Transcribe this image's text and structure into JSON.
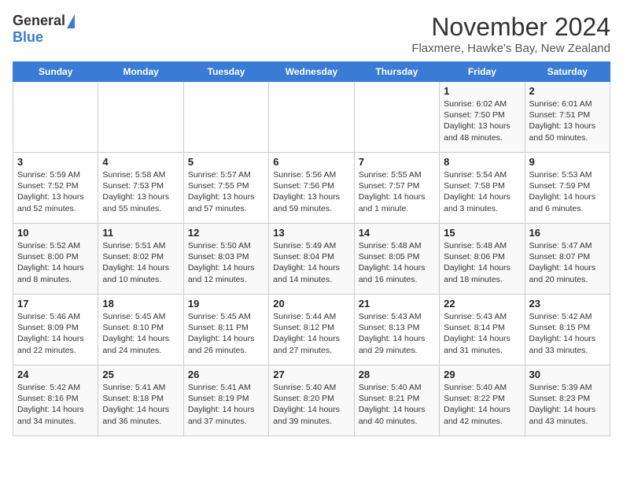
{
  "header": {
    "logo_general": "General",
    "logo_blue": "Blue",
    "month_title": "November 2024",
    "subtitle": "Flaxmere, Hawke's Bay, New Zealand"
  },
  "days_of_week": [
    "Sunday",
    "Monday",
    "Tuesday",
    "Wednesday",
    "Thursday",
    "Friday",
    "Saturday"
  ],
  "weeks": [
    [
      {
        "day": "",
        "info": ""
      },
      {
        "day": "",
        "info": ""
      },
      {
        "day": "",
        "info": ""
      },
      {
        "day": "",
        "info": ""
      },
      {
        "day": "",
        "info": ""
      },
      {
        "day": "1",
        "info": "Sunrise: 6:02 AM\nSunset: 7:50 PM\nDaylight: 13 hours\nand 48 minutes."
      },
      {
        "day": "2",
        "info": "Sunrise: 6:01 AM\nSunset: 7:51 PM\nDaylight: 13 hours\nand 50 minutes."
      }
    ],
    [
      {
        "day": "3",
        "info": "Sunrise: 5:59 AM\nSunset: 7:52 PM\nDaylight: 13 hours\nand 52 minutes."
      },
      {
        "day": "4",
        "info": "Sunrise: 5:58 AM\nSunset: 7:53 PM\nDaylight: 13 hours\nand 55 minutes."
      },
      {
        "day": "5",
        "info": "Sunrise: 5:57 AM\nSunset: 7:55 PM\nDaylight: 13 hours\nand 57 minutes."
      },
      {
        "day": "6",
        "info": "Sunrise: 5:56 AM\nSunset: 7:56 PM\nDaylight: 13 hours\nand 59 minutes."
      },
      {
        "day": "7",
        "info": "Sunrise: 5:55 AM\nSunset: 7:57 PM\nDaylight: 14 hours\nand 1 minute."
      },
      {
        "day": "8",
        "info": "Sunrise: 5:54 AM\nSunset: 7:58 PM\nDaylight: 14 hours\nand 3 minutes."
      },
      {
        "day": "9",
        "info": "Sunrise: 5:53 AM\nSunset: 7:59 PM\nDaylight: 14 hours\nand 6 minutes."
      }
    ],
    [
      {
        "day": "10",
        "info": "Sunrise: 5:52 AM\nSunset: 8:00 PM\nDaylight: 14 hours\nand 8 minutes."
      },
      {
        "day": "11",
        "info": "Sunrise: 5:51 AM\nSunset: 8:02 PM\nDaylight: 14 hours\nand 10 minutes."
      },
      {
        "day": "12",
        "info": "Sunrise: 5:50 AM\nSunset: 8:03 PM\nDaylight: 14 hours\nand 12 minutes."
      },
      {
        "day": "13",
        "info": "Sunrise: 5:49 AM\nSunset: 8:04 PM\nDaylight: 14 hours\nand 14 minutes."
      },
      {
        "day": "14",
        "info": "Sunrise: 5:48 AM\nSunset: 8:05 PM\nDaylight: 14 hours\nand 16 minutes."
      },
      {
        "day": "15",
        "info": "Sunrise: 5:48 AM\nSunset: 8:06 PM\nDaylight: 14 hours\nand 18 minutes."
      },
      {
        "day": "16",
        "info": "Sunrise: 5:47 AM\nSunset: 8:07 PM\nDaylight: 14 hours\nand 20 minutes."
      }
    ],
    [
      {
        "day": "17",
        "info": "Sunrise: 5:46 AM\nSunset: 8:09 PM\nDaylight: 14 hours\nand 22 minutes."
      },
      {
        "day": "18",
        "info": "Sunrise: 5:45 AM\nSunset: 8:10 PM\nDaylight: 14 hours\nand 24 minutes."
      },
      {
        "day": "19",
        "info": "Sunrise: 5:45 AM\nSunset: 8:11 PM\nDaylight: 14 hours\nand 26 minutes."
      },
      {
        "day": "20",
        "info": "Sunrise: 5:44 AM\nSunset: 8:12 PM\nDaylight: 14 hours\nand 27 minutes."
      },
      {
        "day": "21",
        "info": "Sunrise: 5:43 AM\nSunset: 8:13 PM\nDaylight: 14 hours\nand 29 minutes."
      },
      {
        "day": "22",
        "info": "Sunrise: 5:43 AM\nSunset: 8:14 PM\nDaylight: 14 hours\nand 31 minutes."
      },
      {
        "day": "23",
        "info": "Sunrise: 5:42 AM\nSunset: 8:15 PM\nDaylight: 14 hours\nand 33 minutes."
      }
    ],
    [
      {
        "day": "24",
        "info": "Sunrise: 5:42 AM\nSunset: 8:16 PM\nDaylight: 14 hours\nand 34 minutes."
      },
      {
        "day": "25",
        "info": "Sunrise: 5:41 AM\nSunset: 8:18 PM\nDaylight: 14 hours\nand 36 minutes."
      },
      {
        "day": "26",
        "info": "Sunrise: 5:41 AM\nSunset: 8:19 PM\nDaylight: 14 hours\nand 37 minutes."
      },
      {
        "day": "27",
        "info": "Sunrise: 5:40 AM\nSunset: 8:20 PM\nDaylight: 14 hours\nand 39 minutes."
      },
      {
        "day": "28",
        "info": "Sunrise: 5:40 AM\nSunset: 8:21 PM\nDaylight: 14 hours\nand 40 minutes."
      },
      {
        "day": "29",
        "info": "Sunrise: 5:40 AM\nSunset: 8:22 PM\nDaylight: 14 hours\nand 42 minutes."
      },
      {
        "day": "30",
        "info": "Sunrise: 5:39 AM\nSunset: 8:23 PM\nDaylight: 14 hours\nand 43 minutes."
      }
    ]
  ]
}
